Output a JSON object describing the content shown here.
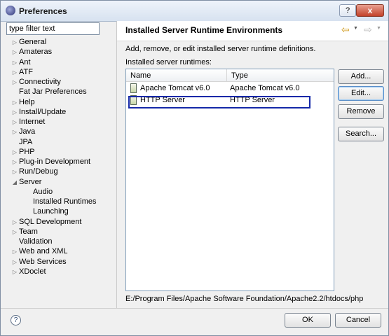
{
  "window": {
    "title": "Preferences",
    "help_glyph": "?",
    "close_glyph": "x"
  },
  "filter": {
    "value": "type filter text"
  },
  "tree": [
    {
      "label": "General",
      "arrow": "▷"
    },
    {
      "label": "Amateras",
      "arrow": "▷"
    },
    {
      "label": "Ant",
      "arrow": "▷"
    },
    {
      "label": "ATF",
      "arrow": "▷"
    },
    {
      "label": "Connectivity",
      "arrow": "▷"
    },
    {
      "label": "Fat Jar Preferences",
      "arrow": ""
    },
    {
      "label": "Help",
      "arrow": "▷"
    },
    {
      "label": "Install/Update",
      "arrow": "▷"
    },
    {
      "label": "Internet",
      "arrow": "▷"
    },
    {
      "label": "Java",
      "arrow": "▷"
    },
    {
      "label": "JPA",
      "arrow": ""
    },
    {
      "label": "PHP",
      "arrow": "▷"
    },
    {
      "label": "Plug-in Development",
      "arrow": "▷"
    },
    {
      "label": "Run/Debug",
      "arrow": "▷"
    },
    {
      "label": "Server",
      "arrow": "◢"
    },
    {
      "label": "Audio",
      "arrow": ""
    },
    {
      "label": "Installed Runtimes",
      "arrow": ""
    },
    {
      "label": "Launching",
      "arrow": ""
    },
    {
      "label": "SQL Development",
      "arrow": "▷"
    },
    {
      "label": "Team",
      "arrow": "▷"
    },
    {
      "label": "Validation",
      "arrow": ""
    },
    {
      "label": "Web and XML",
      "arrow": "▷"
    },
    {
      "label": "Web Services",
      "arrow": "▷"
    },
    {
      "label": "XDoclet",
      "arrow": "▷"
    }
  ],
  "page": {
    "title": "Installed Server Runtime Environments",
    "description": "Add, remove, or edit installed server runtime definitions.",
    "list_label": "Installed server runtimes:",
    "columns": [
      "Name",
      "Type"
    ],
    "rows": [
      {
        "name": "Apache Tomcat v6.0",
        "type": "Apache Tomcat v6.0"
      },
      {
        "name": "HTTP Server",
        "type": "HTTP Server"
      }
    ],
    "path": "E:/Program Files/Apache Software Foundation/Apache2.2/htdocs/php"
  },
  "buttons": {
    "add": "Add...",
    "edit": "Edit...",
    "remove": "Remove",
    "search": "Search...",
    "ok": "OK",
    "cancel": "Cancel"
  },
  "nav": {
    "back_glyph": "⇦",
    "forward_glyph": "⇨",
    "drop_glyph": "▼"
  },
  "help_glyph": "?"
}
